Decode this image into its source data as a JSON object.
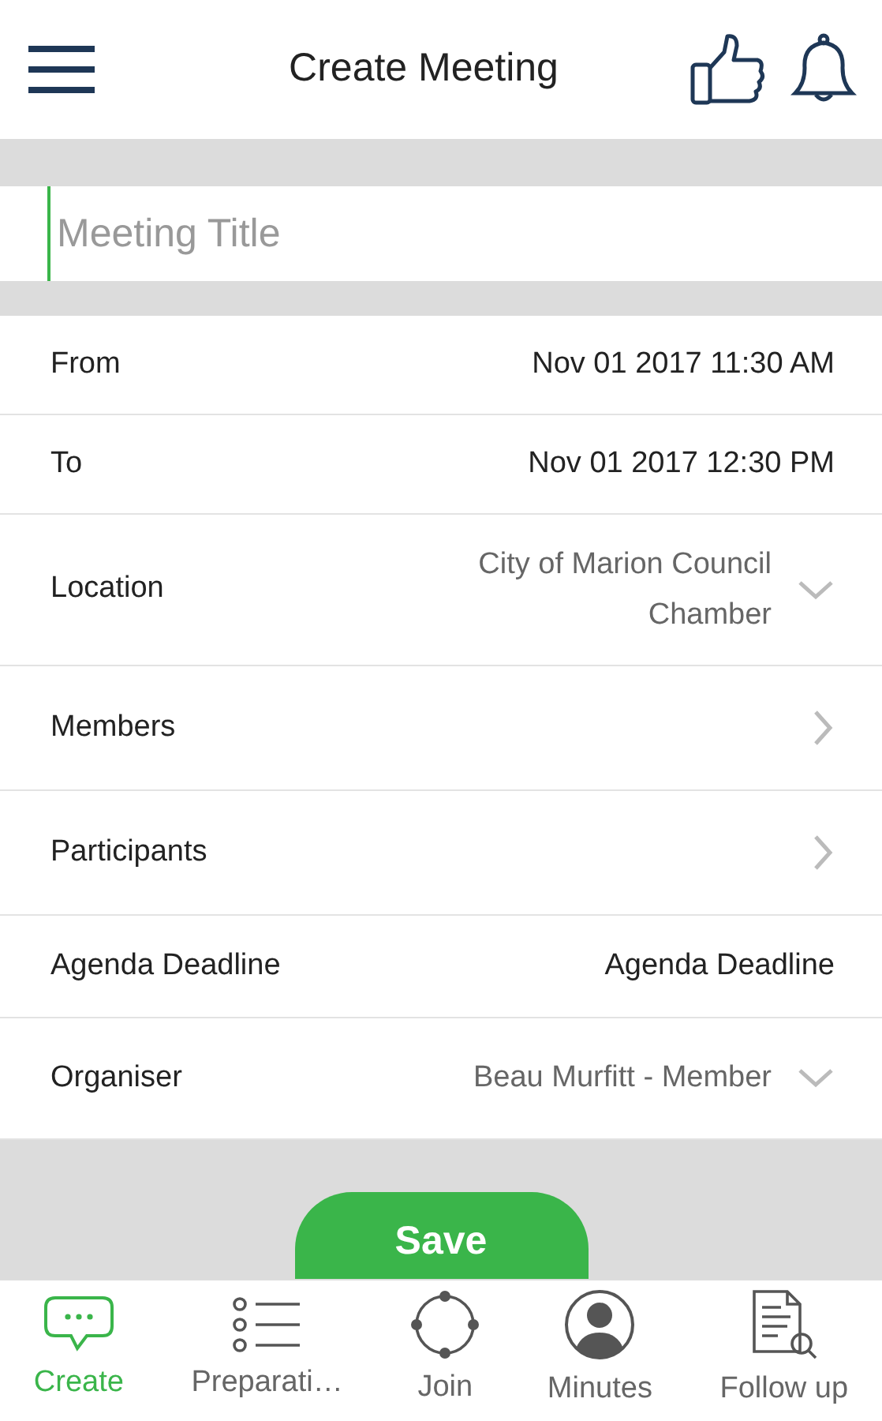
{
  "header": {
    "title": "Create Meeting"
  },
  "title_field": {
    "placeholder": "Meeting Title",
    "focused": true
  },
  "rows": [
    {
      "label": "From",
      "value": "Nov 01 2017 11:30 AM",
      "kind": "value"
    },
    {
      "label": "To",
      "value": "Nov 01 2017 12:30 PM",
      "kind": "value"
    },
    {
      "label": "Location",
      "value": "City of Marion Council Chamber",
      "kind": "dropdown"
    },
    {
      "label": "Members",
      "kind": "link"
    },
    {
      "label": "Participants",
      "kind": "link"
    },
    {
      "label": "Agenda Deadline",
      "value": "Agenda Deadline",
      "kind": "value"
    },
    {
      "label": "Organiser",
      "value": "Beau Murfitt - Member",
      "kind": "dropdown"
    }
  ],
  "save_button": "Save",
  "bottom_nav": [
    {
      "label": "Create",
      "kind": "chat",
      "selected": true
    },
    {
      "label": "Preparati…",
      "kind": "list",
      "selected": false
    },
    {
      "label": "Join",
      "kind": "ring",
      "selected": false
    },
    {
      "label": "Minutes",
      "kind": "person",
      "selected": false
    },
    {
      "label": "Follow up",
      "kind": "doc",
      "selected": false
    }
  ]
}
